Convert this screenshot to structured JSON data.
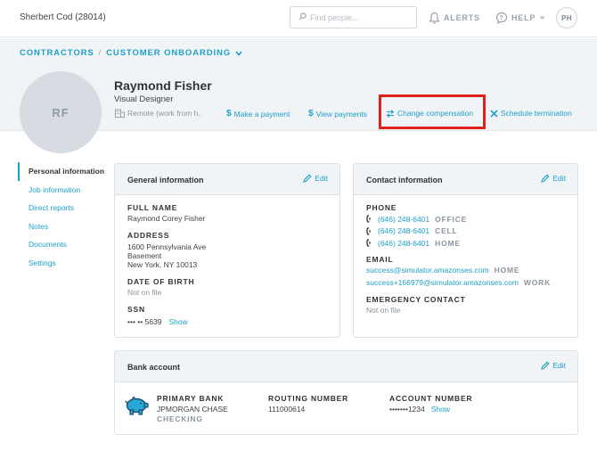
{
  "topbar": {
    "org_name": "Sherbert Cod (28014)",
    "search_placeholder": "Find people...",
    "alerts_label": "ALERTS",
    "help_label": "HELP",
    "user_initials": "PH"
  },
  "breadcrumb": {
    "root": "CONTRACTORS",
    "separator": "/",
    "current": "CUSTOMER ONBOARDING"
  },
  "profile": {
    "initials": "RF",
    "name": "Raymond Fisher",
    "job_title": "Visual Designer",
    "location": "Remote (work from h..",
    "actions": {
      "make_payment": "Make a payment",
      "view_payments": "View payments",
      "change_compensation": "Change compensation",
      "schedule_termination": "Schedule termination"
    }
  },
  "sidemenu": {
    "items": [
      {
        "label": "Personal information",
        "active": true
      },
      {
        "label": "Job information",
        "active": false
      },
      {
        "label": "Direct reports",
        "active": false
      },
      {
        "label": "Notes",
        "active": false
      },
      {
        "label": "Documents",
        "active": false
      },
      {
        "label": "Settings",
        "active": false
      }
    ]
  },
  "general": {
    "title": "General information",
    "edit": "Edit",
    "full_name_label": "FULL NAME",
    "full_name": "Raymond Corey Fisher",
    "address_label": "ADDRESS",
    "address_line1": "1600 Pennsylvania Ave",
    "address_line2": "Basement",
    "address_line3": "New York, NY 10013",
    "dob_label": "DATE OF BIRTH",
    "dob": "Not on file",
    "ssn_label": "SSN",
    "ssn": "••• •• 5639",
    "show": "Show"
  },
  "contact": {
    "title": "Contact information",
    "edit": "Edit",
    "phone_label": "PHONE",
    "phones": [
      {
        "number": "(646) 248-6401",
        "type": "OFFICE"
      },
      {
        "number": "(646) 248-6401",
        "type": "CELL"
      },
      {
        "number": "(646) 248-6401",
        "type": "HOME"
      }
    ],
    "email_label": "EMAIL",
    "emails": [
      {
        "address": "success@simulator.amazonses.com",
        "type": "HOME"
      },
      {
        "address": "success+166979@simulator.amazonses.com",
        "type": "WORK"
      }
    ],
    "emergency_label": "EMERGENCY CONTACT",
    "emergency": "Not on file"
  },
  "bank": {
    "title": "Bank account",
    "edit": "Edit",
    "primary_label": "PRIMARY BANK",
    "bank_name": "JPMORGAN CHASE",
    "account_type": "CHECKING",
    "routing_label": "ROUTING NUMBER",
    "routing_number": "111000614",
    "account_label": "ACCOUNT NUMBER",
    "account_number": "•••••••1234",
    "show": "Show"
  },
  "colors": {
    "accent": "#1e9fc7",
    "highlight_border": "#e0201b",
    "band": "#f1f4f7"
  }
}
